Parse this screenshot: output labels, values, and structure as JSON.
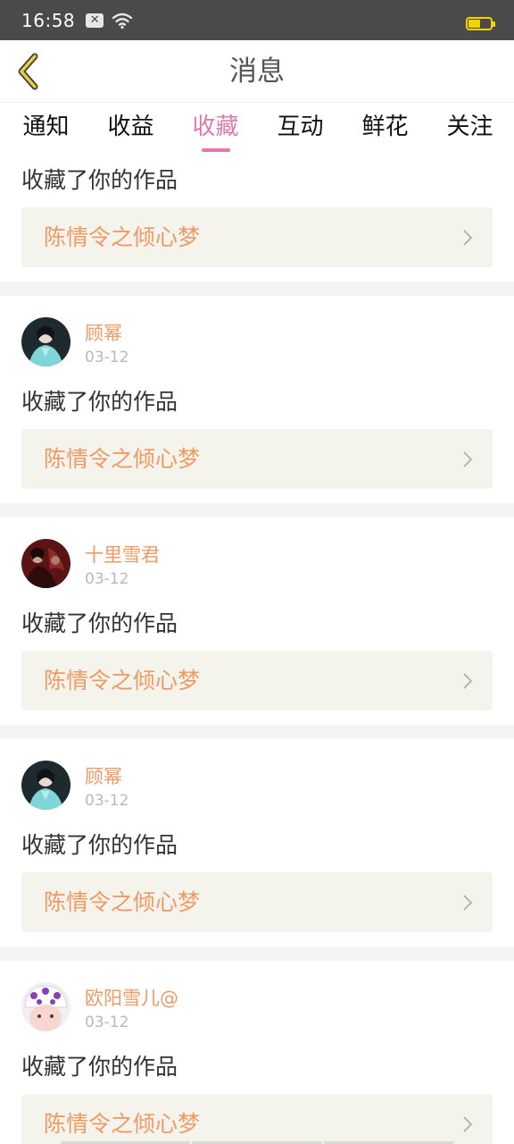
{
  "status_bar": {
    "time": "16:58",
    "notif_icon": "x-icon"
  },
  "header": {
    "title": "消息",
    "back_icon": "back-chevron-icon"
  },
  "tabs": [
    {
      "label": "通知",
      "active": false
    },
    {
      "label": "收益",
      "active": false
    },
    {
      "label": "收藏",
      "active": true
    },
    {
      "label": "互动",
      "active": false
    },
    {
      "label": "鲜花",
      "active": false
    },
    {
      "label": "关注",
      "active": false
    }
  ],
  "colors": {
    "accent": "#e07aae",
    "username": "#ef9a63",
    "work_box_bg": "#f4f4ec"
  },
  "feed": {
    "partial_top": {
      "action": "收藏了你的作品",
      "work_title": "陈情令之倾心梦"
    },
    "items": [
      {
        "username": "顾幂",
        "date": "03-12",
        "action": "收藏了你的作品",
        "work_title": "陈情令之倾心梦"
      },
      {
        "username": "十里雪君",
        "date": "03-12",
        "action": "收藏了你的作品",
        "work_title": "陈情令之倾心梦"
      },
      {
        "username": "顾幂",
        "date": "03-12",
        "action": "收藏了你的作品",
        "work_title": "陈情令之倾心梦"
      },
      {
        "username": "欧阳雪儿@",
        "date": "03-12",
        "action": "收藏了你的作品",
        "work_title": "陈情令之倾心梦"
      }
    ]
  }
}
